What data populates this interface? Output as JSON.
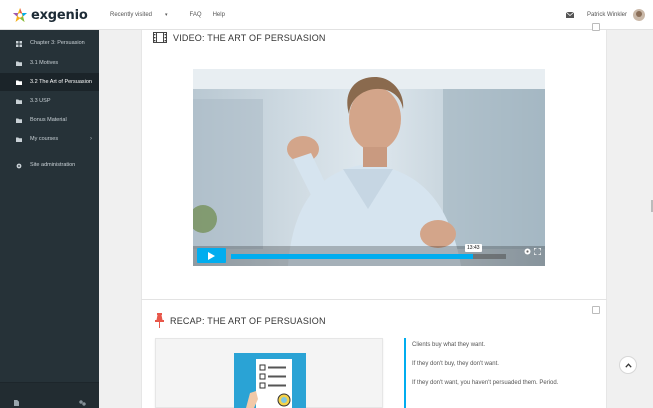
{
  "brand": {
    "name": "exgenio"
  },
  "topnav": {
    "recently_visited": "Recently visited",
    "faq": "FAQ",
    "help": "Help",
    "user_name": "Patrick Winkler"
  },
  "sidebar": {
    "items": [
      {
        "label": "Chapter 3: Persuasion",
        "icon": "grid-icon"
      },
      {
        "label": "3.1 Motives",
        "icon": "folder-icon"
      },
      {
        "label": "3.2 The Art of Persuasion",
        "icon": "folder-icon",
        "active": true
      },
      {
        "label": "3.3 USP",
        "icon": "folder-icon"
      },
      {
        "label": "Bonus Material",
        "icon": "folder-icon"
      },
      {
        "label": "My courses",
        "icon": "folder-icon"
      },
      {
        "label": "Site administration",
        "icon": "gear-icon"
      }
    ]
  },
  "video_section": {
    "title": "VIDEO: THE ART OF PERSUASION",
    "current_time": "13:43",
    "progress": 0.88
  },
  "recap_section": {
    "title": "RECAP: THE ART OF PERSUASION",
    "lines": [
      "Clients buy what they want.",
      "If they don't buy, they don't want.",
      "If they don't want, you haven't persuaded them. Period."
    ]
  },
  "colors": {
    "accent": "#00adef",
    "sidebar_bg": "#263238",
    "pin": "#e8574a"
  }
}
